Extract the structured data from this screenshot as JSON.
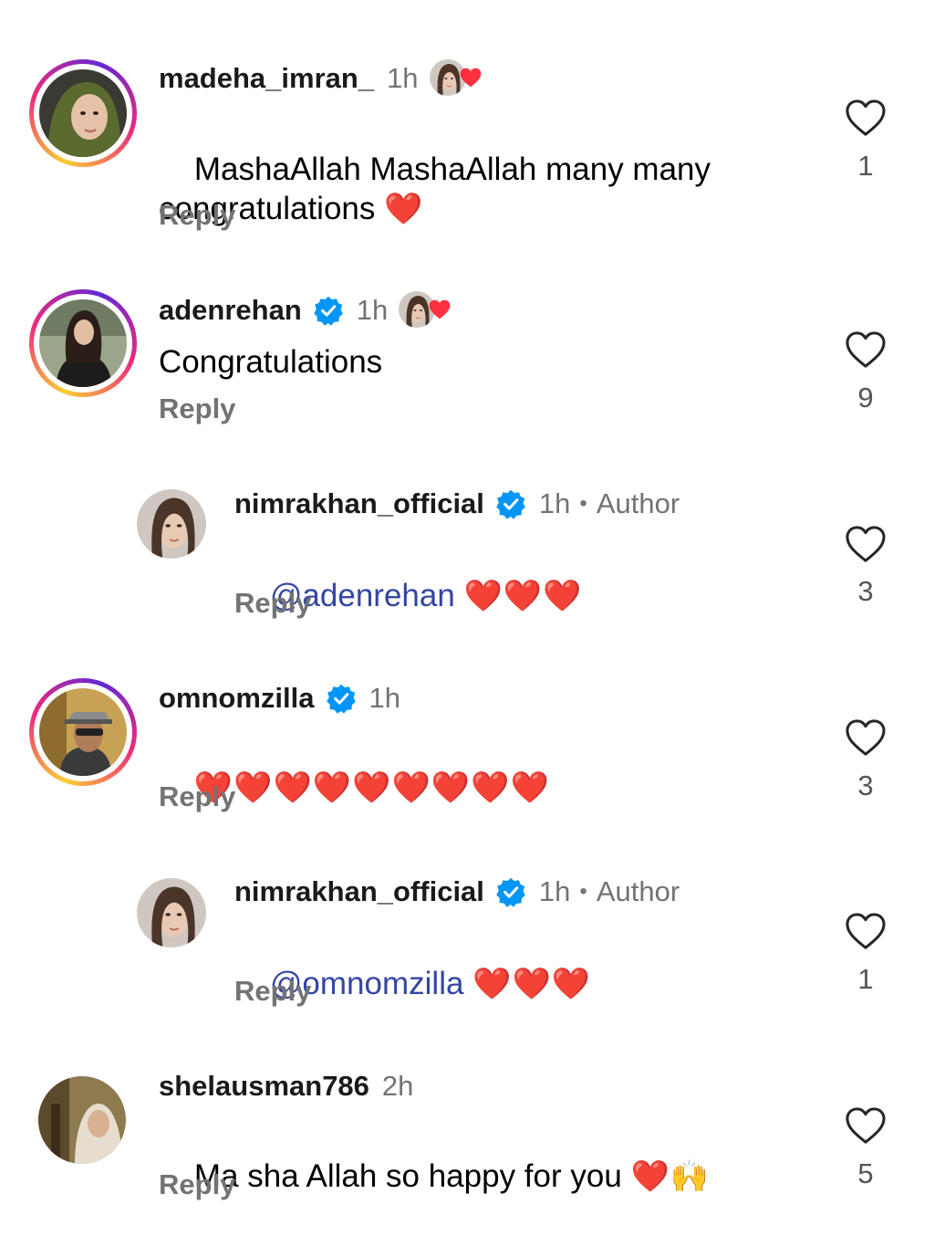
{
  "comments": [
    {
      "username": "madeha_imran_",
      "time": "1h",
      "text_line1": "MashaAllah MashaAllah many many",
      "text_line2": "congratulations",
      "emoji": "❤️",
      "reply": "Reply",
      "likes": "1"
    },
    {
      "username": "adenrehan",
      "time": "1h",
      "text": "Congratulations",
      "reply": "Reply",
      "likes": "9"
    },
    {
      "username": "nimrakhan_official",
      "time": "1h",
      "author": "Author",
      "dot": "•",
      "mention": "@adenrehan",
      "emoji": "❤️❤️❤️",
      "reply": "Reply",
      "likes": "3"
    },
    {
      "username": "omnomzilla",
      "time": "1h",
      "emoji": "❤️❤️❤️❤️❤️❤️❤️❤️❤️",
      "reply": "Reply",
      "likes": "3"
    },
    {
      "username": "nimrakhan_official",
      "time": "1h",
      "author": "Author",
      "dot": "•",
      "mention": "@omnomzilla",
      "emoji": "❤️❤️❤️",
      "reply": "Reply",
      "likes": "1"
    },
    {
      "username": "shelausman786",
      "time": "2h",
      "text": "Ma sha Allah so happy for you ",
      "emoji": "❤️🙌",
      "reply": "Reply",
      "likes": "5"
    }
  ],
  "colors": {
    "heart_red": "#ff3040",
    "verified_blue": "#0095f6",
    "mention": "#3346a3",
    "muted": "#737373"
  },
  "icons": {
    "like": "heart-outline-icon",
    "verified": "verified-badge-icon",
    "author_like": "heart-filled-icon"
  }
}
